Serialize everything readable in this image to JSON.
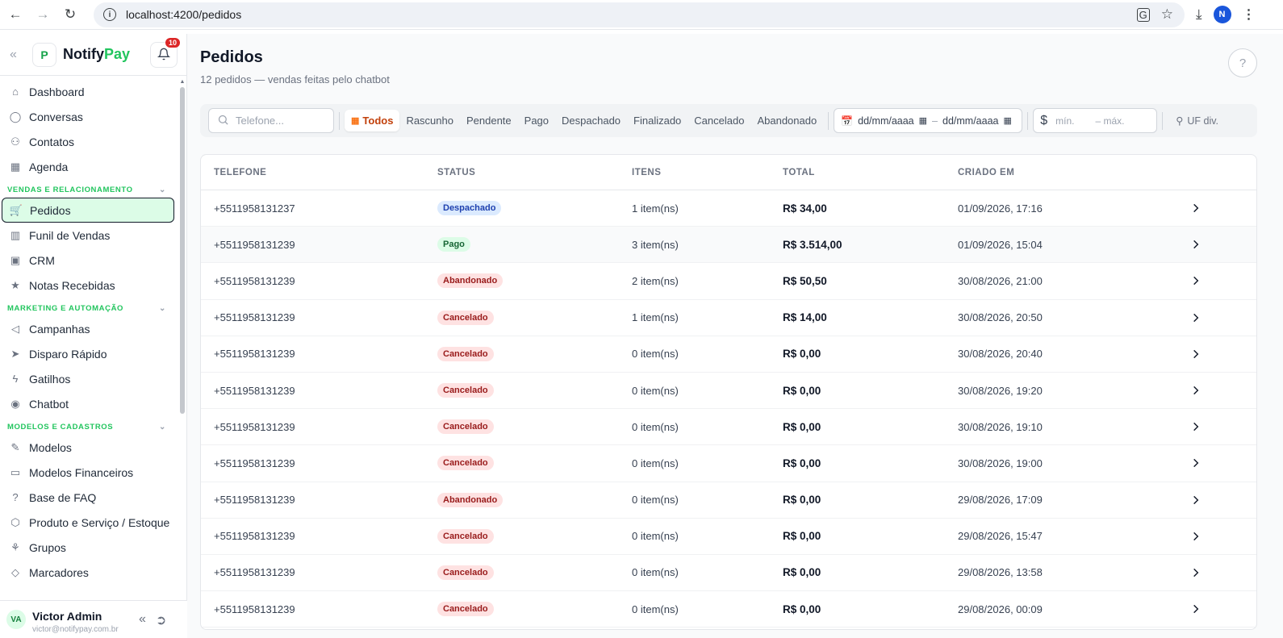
{
  "browser": {
    "url": "localhost:4200/pedidos",
    "profile_initial": "N"
  },
  "brand": {
    "logo_text": "P",
    "name_part1": "Notify",
    "name_part2": "Pay",
    "notification_count": "10"
  },
  "sidebar": {
    "top_items": [
      {
        "label": "Dashboard",
        "icon": "home-icon"
      },
      {
        "label": "Conversas",
        "icon": "chat-icon"
      },
      {
        "label": "Contatos",
        "icon": "contacts-icon"
      },
      {
        "label": "Agenda",
        "icon": "calendar-icon"
      }
    ],
    "sections": [
      {
        "title": "VENDAS E RELACIONAMENTO",
        "items": [
          {
            "label": "Pedidos",
            "icon": "cart-icon",
            "active": true
          },
          {
            "label": "Funil de Vendas",
            "icon": "funnel-icon"
          },
          {
            "label": "CRM",
            "icon": "crm-icon"
          },
          {
            "label": "Notas Recebidas",
            "icon": "star-icon"
          }
        ]
      },
      {
        "title": "MARKETING E AUTOMAÇÃO",
        "items": [
          {
            "label": "Campanhas",
            "icon": "megaphone-icon"
          },
          {
            "label": "Disparo Rápido",
            "icon": "send-icon"
          },
          {
            "label": "Gatilhos",
            "icon": "bolt-icon"
          },
          {
            "label": "Chatbot",
            "icon": "android-icon"
          }
        ]
      },
      {
        "title": "MODELOS E CADASTROS",
        "items": [
          {
            "label": "Modelos",
            "icon": "template-icon"
          },
          {
            "label": "Modelos Financeiros",
            "icon": "finance-icon"
          },
          {
            "label": "Base de FAQ",
            "icon": "help-icon"
          },
          {
            "label": "Produto e Serviço / Estoque",
            "icon": "box-icon"
          },
          {
            "label": "Grupos",
            "icon": "groups-icon"
          },
          {
            "label": "Marcadores",
            "icon": "tag-icon"
          }
        ]
      }
    ]
  },
  "user": {
    "initials": "VA",
    "name": "Victor Admin",
    "email": "victor@notifypay.com.br"
  },
  "page": {
    "title": "Pedidos",
    "subtitle": "12 pedidos — vendas feitas pelo chatbot",
    "help_label": "?"
  },
  "filters": {
    "search_placeholder": "Telefone...",
    "status_chips": [
      "Todos",
      "Rascunho",
      "Pendente",
      "Pago",
      "Despachado",
      "Finalizado",
      "Cancelado",
      "Abandonado"
    ],
    "active_chip": "Todos",
    "date_from": "dd/mm/aaaa",
    "date_sep": "–",
    "date_to": "dd/mm/aaaa",
    "min_placeholder": "mín.",
    "max_placeholder": "– máx.",
    "uf_label": "UF div."
  },
  "table": {
    "headers": {
      "telefone": "TELEFONE",
      "status": "STATUS",
      "itens": "ITENS",
      "total": "TOTAL",
      "criado": "CRIADO EM"
    },
    "rows": [
      {
        "telefone": "+5511958131237",
        "status": "Despachado",
        "status_kind": "despachado",
        "itens": "1 item(ns)",
        "total": "R$ 34,00",
        "criado": "01/09/2026, 17:16"
      },
      {
        "telefone": "+5511958131239",
        "status": "Pago",
        "status_kind": "pago",
        "itens": "3 item(ns)",
        "total": "R$ 3.514,00",
        "criado": "01/09/2026, 15:04"
      },
      {
        "telefone": "+5511958131239",
        "status": "Abandonado",
        "status_kind": "abandonado",
        "itens": "2 item(ns)",
        "total": "R$ 50,50",
        "criado": "30/08/2026, 21:00"
      },
      {
        "telefone": "+5511958131239",
        "status": "Cancelado",
        "status_kind": "cancelado",
        "itens": "1 item(ns)",
        "total": "R$ 14,00",
        "criado": "30/08/2026, 20:50"
      },
      {
        "telefone": "+5511958131239",
        "status": "Cancelado",
        "status_kind": "cancelado",
        "itens": "0 item(ns)",
        "total": "R$ 0,00",
        "criado": "30/08/2026, 20:40"
      },
      {
        "telefone": "+5511958131239",
        "status": "Cancelado",
        "status_kind": "cancelado",
        "itens": "0 item(ns)",
        "total": "R$ 0,00",
        "criado": "30/08/2026, 19:20"
      },
      {
        "telefone": "+5511958131239",
        "status": "Cancelado",
        "status_kind": "cancelado",
        "itens": "0 item(ns)",
        "total": "R$ 0,00",
        "criado": "30/08/2026, 19:10"
      },
      {
        "telefone": "+5511958131239",
        "status": "Cancelado",
        "status_kind": "cancelado",
        "itens": "0 item(ns)",
        "total": "R$ 0,00",
        "criado": "30/08/2026, 19:00"
      },
      {
        "telefone": "+5511958131239",
        "status": "Abandonado",
        "status_kind": "abandonado",
        "itens": "0 item(ns)",
        "total": "R$ 0,00",
        "criado": "29/08/2026, 17:09"
      },
      {
        "telefone": "+5511958131239",
        "status": "Cancelado",
        "status_kind": "cancelado",
        "itens": "0 item(ns)",
        "total": "R$ 0,00",
        "criado": "29/08/2026, 15:47"
      },
      {
        "telefone": "+5511958131239",
        "status": "Cancelado",
        "status_kind": "cancelado",
        "itens": "0 item(ns)",
        "total": "R$ 0,00",
        "criado": "29/08/2026, 13:58"
      },
      {
        "telefone": "+5511958131239",
        "status": "Cancelado",
        "status_kind": "cancelado",
        "itens": "0 item(ns)",
        "total": "R$ 0,00",
        "criado": "29/08/2026, 00:09"
      }
    ]
  },
  "colors": {
    "accent_green": "#22c55e",
    "active_bg": "#dcfce7",
    "chip_active": "#c2410c"
  }
}
